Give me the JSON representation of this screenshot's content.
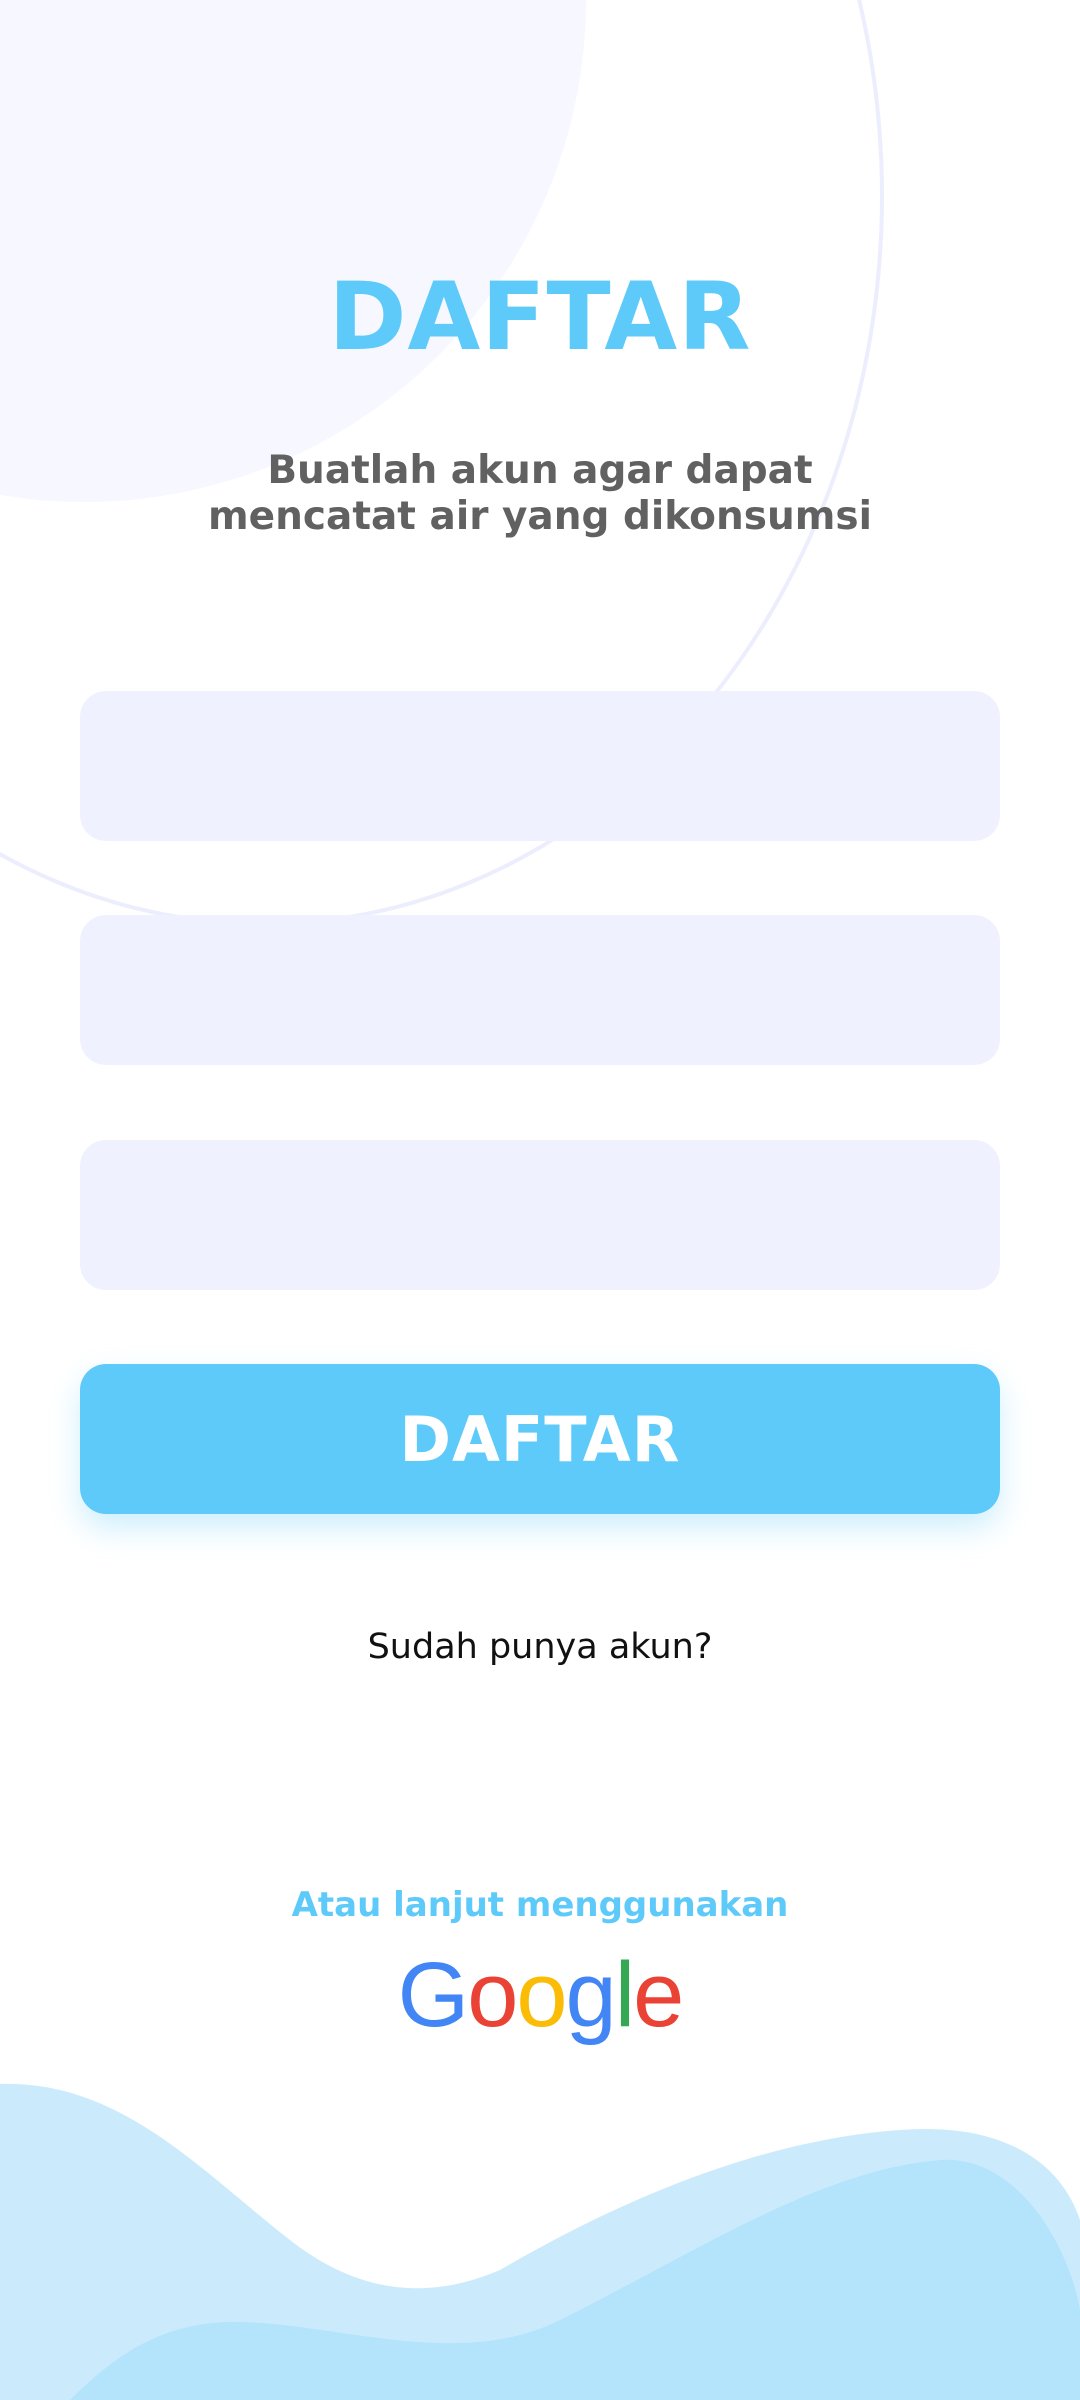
{
  "header": {
    "title": "DAFTAR",
    "subtitle_line1": "Buatlah akun agar dapat",
    "subtitle_line2": "mencatat air yang dikonsumsi"
  },
  "form": {
    "fields": [
      {
        "value": "",
        "placeholder": ""
      },
      {
        "value": "",
        "placeholder": ""
      },
      {
        "value": "",
        "placeholder": ""
      }
    ],
    "submit_label": "DAFTAR"
  },
  "login_prompt": "Sudah punya akun?",
  "alternative": {
    "text": "Atau lanjut menggunakan",
    "google_letters": [
      "G",
      "o",
      "o",
      "g",
      "l",
      "e"
    ]
  },
  "colors": {
    "accent": "#5ecafa",
    "field_background": "#eff2fe",
    "subtitle_text": "#616161",
    "wave_light": "#cbebfc",
    "wave_mid": "#b3e4fb"
  }
}
